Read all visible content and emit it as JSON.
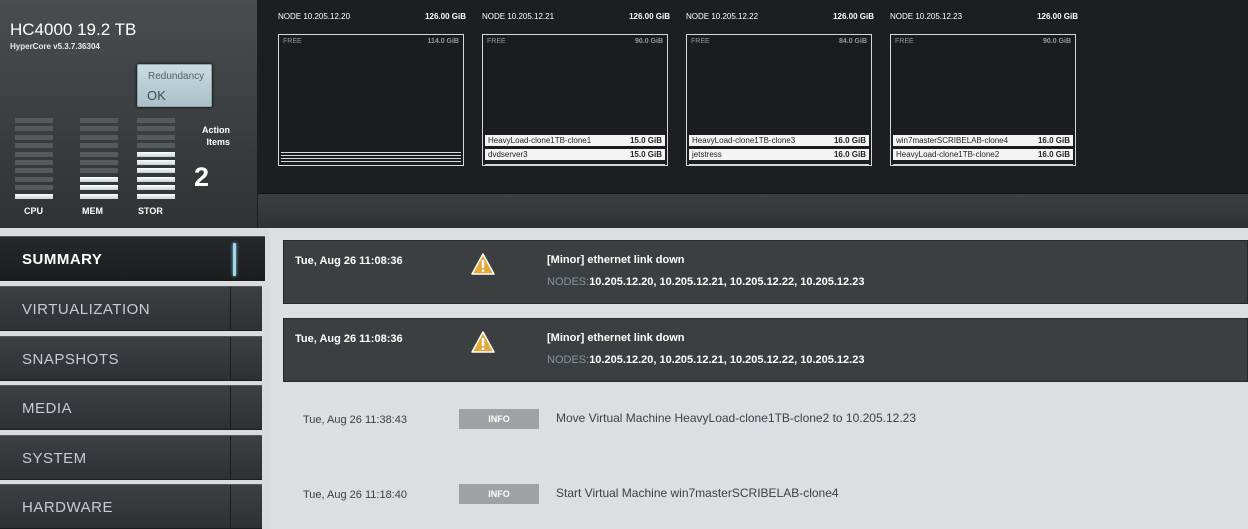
{
  "cluster": {
    "title": "HC4000 19.2 TB",
    "version": "HyperCore v5.3.7.36304",
    "redundancy_label": "Redundancy",
    "redundancy_value": "OK",
    "action_items_label_1": "Action",
    "action_items_label_2": "Items",
    "action_items_count": "2",
    "meters": [
      {
        "label": "CPU",
        "level": 1
      },
      {
        "label": "MEM",
        "level": 3
      },
      {
        "label": "STOR",
        "level": 6
      }
    ],
    "meter_total_segments": 10
  },
  "nodes": [
    {
      "ip": "NODE 10.205.12.20",
      "capacity": "126.00 GiB",
      "free_label": "FREE",
      "free_value": "114.0 GiB",
      "vms": []
    },
    {
      "ip": "NODE 10.205.12.21",
      "capacity": "126.00 GiB",
      "free_label": "FREE",
      "free_value": "90.0 GiB",
      "vms": [
        {
          "name": "HeavyLoad-clone1TB-clone1",
          "size": "15.0 GiB"
        },
        {
          "name": "dvdserver3",
          "size": "15.0 GiB"
        }
      ]
    },
    {
      "ip": "NODE 10.205.12.22",
      "capacity": "126.00 GiB",
      "free_label": "FREE",
      "free_value": "84.0 GiB",
      "vms": [
        {
          "name": "HeavyLoad-clone1TB-clone3",
          "size": "16.0 GiB"
        },
        {
          "name": "jetstress",
          "size": "16.0 GiB"
        }
      ]
    },
    {
      "ip": "NODE 10.205.12.23",
      "capacity": "126.00 GiB",
      "free_label": "FREE",
      "free_value": "90.0 GiB",
      "vms": [
        {
          "name": "win7masterSCRIBELAB-clone4",
          "size": "16.0 GiB"
        },
        {
          "name": "HeavyLoad-clone1TB-clone2",
          "size": "16.0 GiB"
        }
      ]
    }
  ],
  "nav": {
    "items": [
      {
        "label": "SUMMARY",
        "active": true
      },
      {
        "label": "VIRTUALIZATION",
        "active": false
      },
      {
        "label": "SNAPSHOTS",
        "active": false
      },
      {
        "label": "MEDIA",
        "active": false
      },
      {
        "label": "SYSTEM",
        "active": false
      },
      {
        "label": "HARDWARE",
        "active": false
      }
    ]
  },
  "events": {
    "alerts": [
      {
        "date": "Tue, Aug 26  11:08:36",
        "title": "[Minor] ethernet link down",
        "nodes_prefix": "NODES:",
        "nodes": "10.205.12.20, 10.205.12.21, 10.205.12.22, 10.205.12.23"
      },
      {
        "date": "Tue, Aug 26  11:08:36",
        "title": "[Minor] ethernet link down",
        "nodes_prefix": "NODES:",
        "nodes": "10.205.12.20, 10.205.12.21, 10.205.12.22, 10.205.12.23"
      }
    ],
    "info": [
      {
        "date": "Tue, Aug 26  11:38:43",
        "badge": "INFO",
        "message": "Move Virtual Machine HeavyLoad-clone1TB-clone2 to 10.205.12.23"
      },
      {
        "date": "Tue, Aug 26  11:18:40",
        "badge": "INFO",
        "message": "Start Virtual Machine win7masterSCRIBELAB-clone4"
      }
    ]
  },
  "colors": {
    "active_indicator": "#9fd5ef",
    "warning": "#e3a93a",
    "info_badge": "#9ea2a5"
  },
  "icons": {
    "alert": "warning-triangle-icon"
  }
}
